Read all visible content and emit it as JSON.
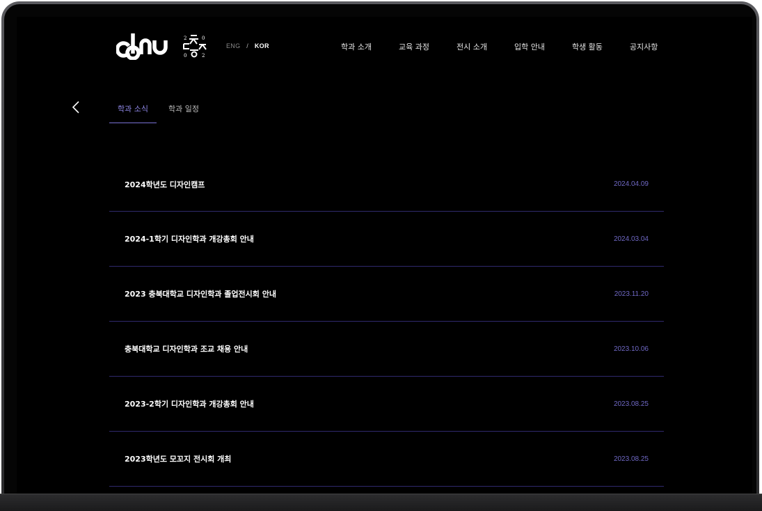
{
  "header": {
    "logo_text": "cbnu",
    "emblem_text": "2촌0 ㄷ윂2 0",
    "lang": {
      "eng": "ENG",
      "separator": "/",
      "kor": "KOR",
      "active": "KOR"
    },
    "nav": [
      "학과 소개",
      "교육 과정",
      "전시 소개",
      "입학 안내",
      "학생 활동",
      "공지사항"
    ]
  },
  "tabs": [
    {
      "label": "학과 소식",
      "active": true
    },
    {
      "label": "학과 일정",
      "active": false
    }
  ],
  "posts": [
    {
      "title": "2024학년도 디자인캠프",
      "date": "2024.04.09"
    },
    {
      "title": "2024-1학기 디자인학과 개강총회 안내",
      "date": "2024.03.04"
    },
    {
      "title": "2023 충북대학교 디자인학과 졸업전시회 안내",
      "date": "2023.11.20"
    },
    {
      "title": "충북대학교 디자인학과 조교 채용 안내",
      "date": "2023.10.06"
    },
    {
      "title": "2023-2학기 디자인학과 개강총회 안내",
      "date": "2023.08.25"
    },
    {
      "title": "2023학년도 모꼬지 전시회 개최",
      "date": "2023.08.25"
    }
  ],
  "colors": {
    "background": "#000000",
    "accent": "#7a73d6",
    "divider": "#2f2a6e",
    "date": "#6f68c4"
  },
  "icons": {
    "back": "chevron-left-icon"
  }
}
